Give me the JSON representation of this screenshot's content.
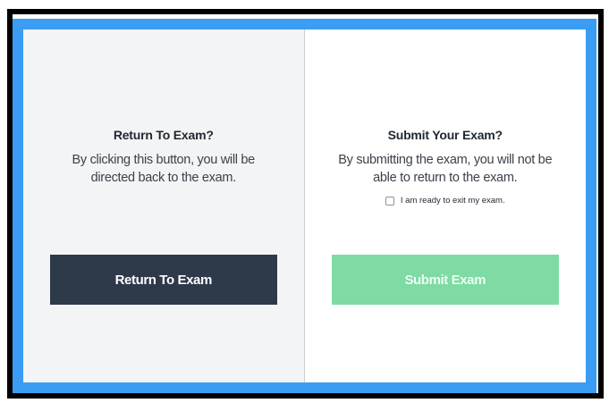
{
  "return_panel": {
    "title": "Return To Exam?",
    "description": "By clicking this button, you will be directed back to the exam.",
    "button_label": "Return To Exam"
  },
  "submit_panel": {
    "title": "Submit Your Exam?",
    "description": "By submitting the exam, you will not be able to return to the exam.",
    "confirm_label": "I am ready to exit my exam.",
    "confirm_checked": false,
    "button_label": "Submit Exam"
  },
  "colors": {
    "frame_border": "#000000",
    "dialog_border": "#3a9cf2",
    "return_panel_bg": "#f3f4f6",
    "return_button": "#2e3a4a",
    "submit_button": "#7fdaa3"
  }
}
